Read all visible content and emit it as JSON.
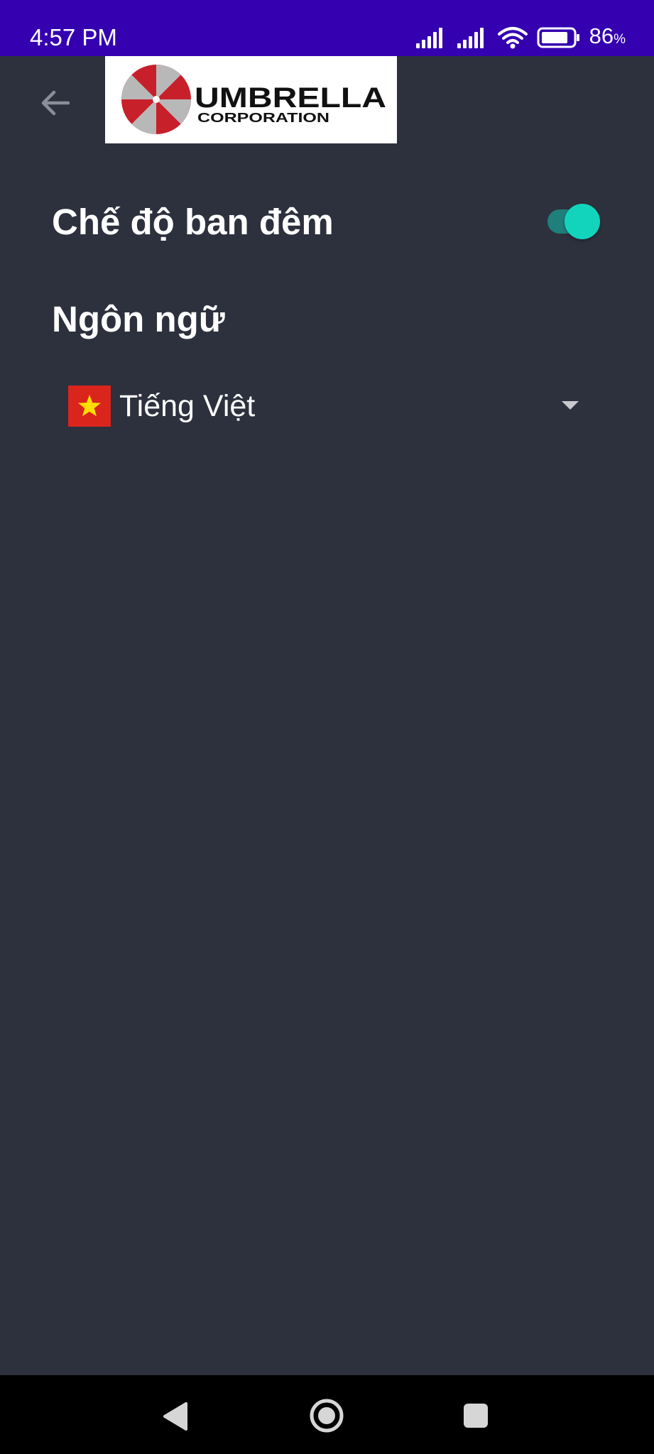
{
  "status_bar": {
    "time": "4:57 PM",
    "battery_percent": "86",
    "battery_unit": "%",
    "battery_level": 0.86,
    "icons": [
      "signal-icon",
      "signal-icon",
      "wifi-icon",
      "battery-icon"
    ]
  },
  "app_bar": {
    "back_icon": "arrow-left-icon",
    "logo": {
      "name": "UMBRELLA",
      "subtitle": "CORPORATION"
    }
  },
  "settings": {
    "night_mode": {
      "label": "Chế độ ban đêm",
      "enabled": true
    },
    "language": {
      "section_title": "Ngôn ngữ",
      "selected": "Tiếng Việt",
      "flag": "vietnam-flag-icon",
      "dropdown_icon": "caret-down-icon"
    }
  },
  "colors": {
    "status_bar": "#3400b0",
    "background": "#2d313d",
    "toggle_accent": "#12d4bd",
    "logo_red": "#c8202a"
  },
  "nav_bar": {
    "icons": [
      "back-triangle-icon",
      "home-circle-icon",
      "recents-square-icon"
    ]
  }
}
